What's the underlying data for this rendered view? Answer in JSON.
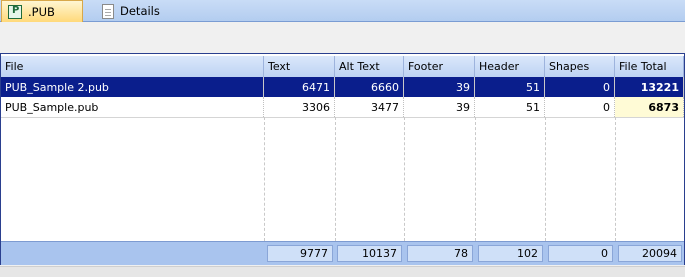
{
  "tabs": [
    {
      "label": ".PUB",
      "icon": "publisher-icon",
      "active": true
    },
    {
      "label": "Details",
      "icon": "document-icon",
      "active": false
    }
  ],
  "grid": {
    "columns": [
      "File",
      "Text",
      "Alt Text",
      "Footer",
      "Header",
      "Shapes",
      "File Total"
    ],
    "rows": [
      {
        "file": "PUB_Sample 2.pub",
        "text": "6471",
        "alt_text": "6660",
        "footer": "39",
        "header": "51",
        "shapes": "0",
        "file_total": "13221",
        "selected": true
      },
      {
        "file": "PUB_Sample.pub",
        "text": "3306",
        "alt_text": "3477",
        "footer": "39",
        "header": "51",
        "shapes": "0",
        "file_total": "6873",
        "selected": false
      }
    ],
    "totals": {
      "text": "9777",
      "alt_text": "10137",
      "footer": "78",
      "header": "102",
      "shapes": "0",
      "file_total": "20094"
    }
  },
  "colors": {
    "selection": "#0a1e8c",
    "header": "#bdd3f3",
    "footer": "#a9c4ee",
    "highlight": "#fffbd6"
  }
}
